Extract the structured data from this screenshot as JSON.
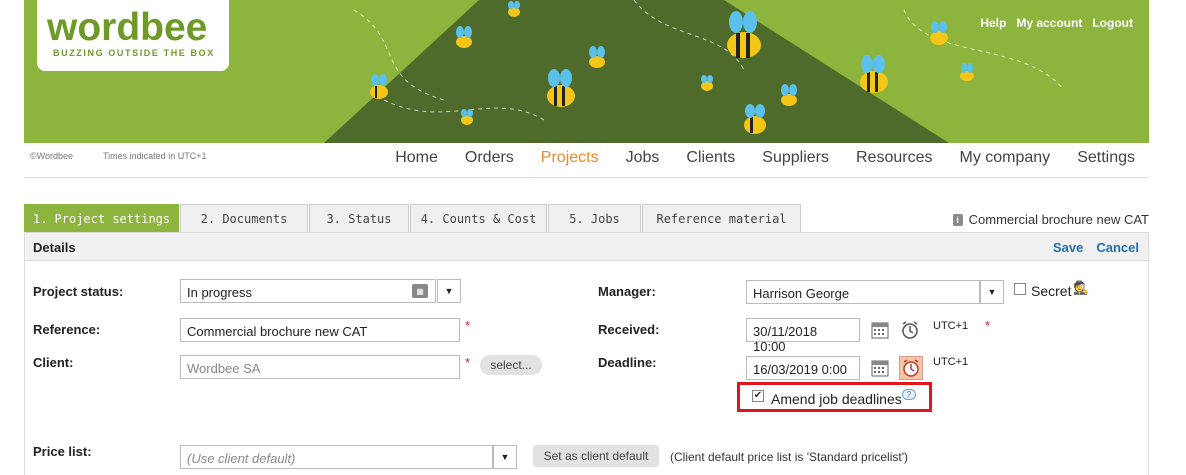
{
  "brand": {
    "logo_text": "wordbee",
    "tagline": "BUZZING OUTSIDE THE BOX",
    "primary_color": "#8db43c",
    "accent_color": "#f08a24"
  },
  "top_links": {
    "help": "Help",
    "my_account": "My account",
    "logout": "Logout"
  },
  "info": {
    "copyright": "©Wordbee",
    "timezone_note": "Times indicated in UTC+1"
  },
  "main_nav": {
    "home": "Home",
    "orders": "Orders",
    "projects": "Projects",
    "jobs": "Jobs",
    "clients": "Clients",
    "suppliers": "Suppliers",
    "resources": "Resources",
    "my_company": "My company",
    "settings": "Settings",
    "active": "Projects"
  },
  "tabs": {
    "project_settings": "1. Project settings",
    "documents": "2. Documents",
    "status": "3. Status",
    "counts_cost": "4. Counts & Cost",
    "jobs": "5. Jobs",
    "reference_material": "Reference material"
  },
  "project_title": "Commercial brochure new CAT",
  "panel": {
    "title": "Details",
    "save": "Save",
    "cancel": "Cancel"
  },
  "form": {
    "project_status": {
      "label": "Project status:",
      "value": "In progress"
    },
    "reference": {
      "label": "Reference:",
      "value": "Commercial brochure new CAT",
      "required": "*"
    },
    "client": {
      "label": "Client:",
      "value": "Wordbee SA",
      "required": "*",
      "select_label": "select..."
    },
    "manager": {
      "label": "Manager:",
      "value": "Harrison George"
    },
    "secret": {
      "label": "Secret",
      "checked": false
    },
    "received": {
      "label": "Received:",
      "value": "30/11/2018 10:00",
      "tz": "UTC+1",
      "required": "*"
    },
    "deadline": {
      "label": "Deadline:",
      "value": "16/03/2019 0:00",
      "tz": "UTC+1"
    },
    "amend_job_deadlines": {
      "label": "Amend job deadlines",
      "checked": true,
      "help": "?"
    },
    "price_list": {
      "label": "Price list:",
      "placeholder": "(Use client default)",
      "set_default_label": "Set as client default",
      "note": "(Client default price list is 'Standard pricelist')"
    }
  }
}
